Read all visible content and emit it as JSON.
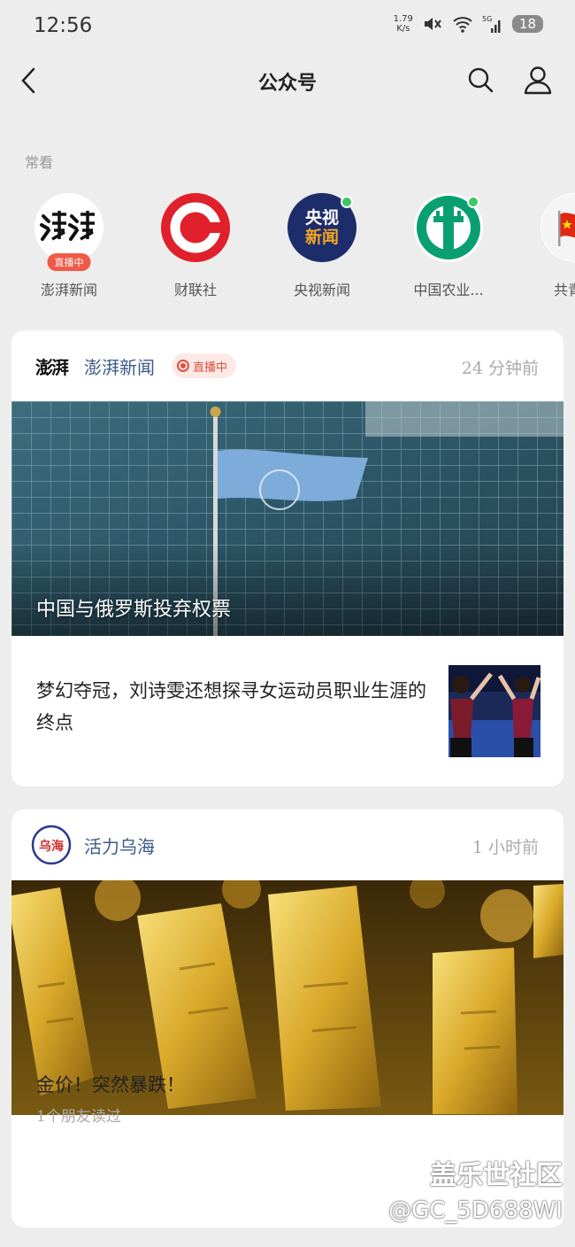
{
  "status": {
    "time": "12:56",
    "speed_value": "1.79",
    "speed_unit": "K/s",
    "network": "5G",
    "battery": "18"
  },
  "nav": {
    "title": "公众号"
  },
  "frequent": {
    "label": "常看",
    "items": [
      {
        "name": "澎湃新闻",
        "live": "直播中"
      },
      {
        "name": "财联社"
      },
      {
        "name": "央视新闻"
      },
      {
        "name": "中国农业..."
      },
      {
        "name": "共青团"
      }
    ]
  },
  "card1": {
    "source": "澎湃新闻",
    "live": "直播中",
    "time": "24 分钟前",
    "hero_caption": "中国与俄罗斯投弃权票",
    "sub_title": "梦幻夺冠，刘诗雯还想探寻女运动员职业生涯的终点"
  },
  "card2": {
    "source": "活力乌海",
    "time": "1 小时前",
    "title": "金价！突然暴跌！",
    "meta": "1个朋友读过"
  },
  "logos": {
    "pengpai_small": "澎湃",
    "cctv_top": "央视",
    "cctv_bottom": "新闻",
    "wuhai": "乌海"
  },
  "watermark": {
    "line1": "盖乐世社区",
    "line2": "@GC_5D688WI"
  },
  "colors": {
    "accent_blue": "#3c5a8a",
    "live_red": "#ef5a47",
    "online_green": "#3cc862"
  }
}
